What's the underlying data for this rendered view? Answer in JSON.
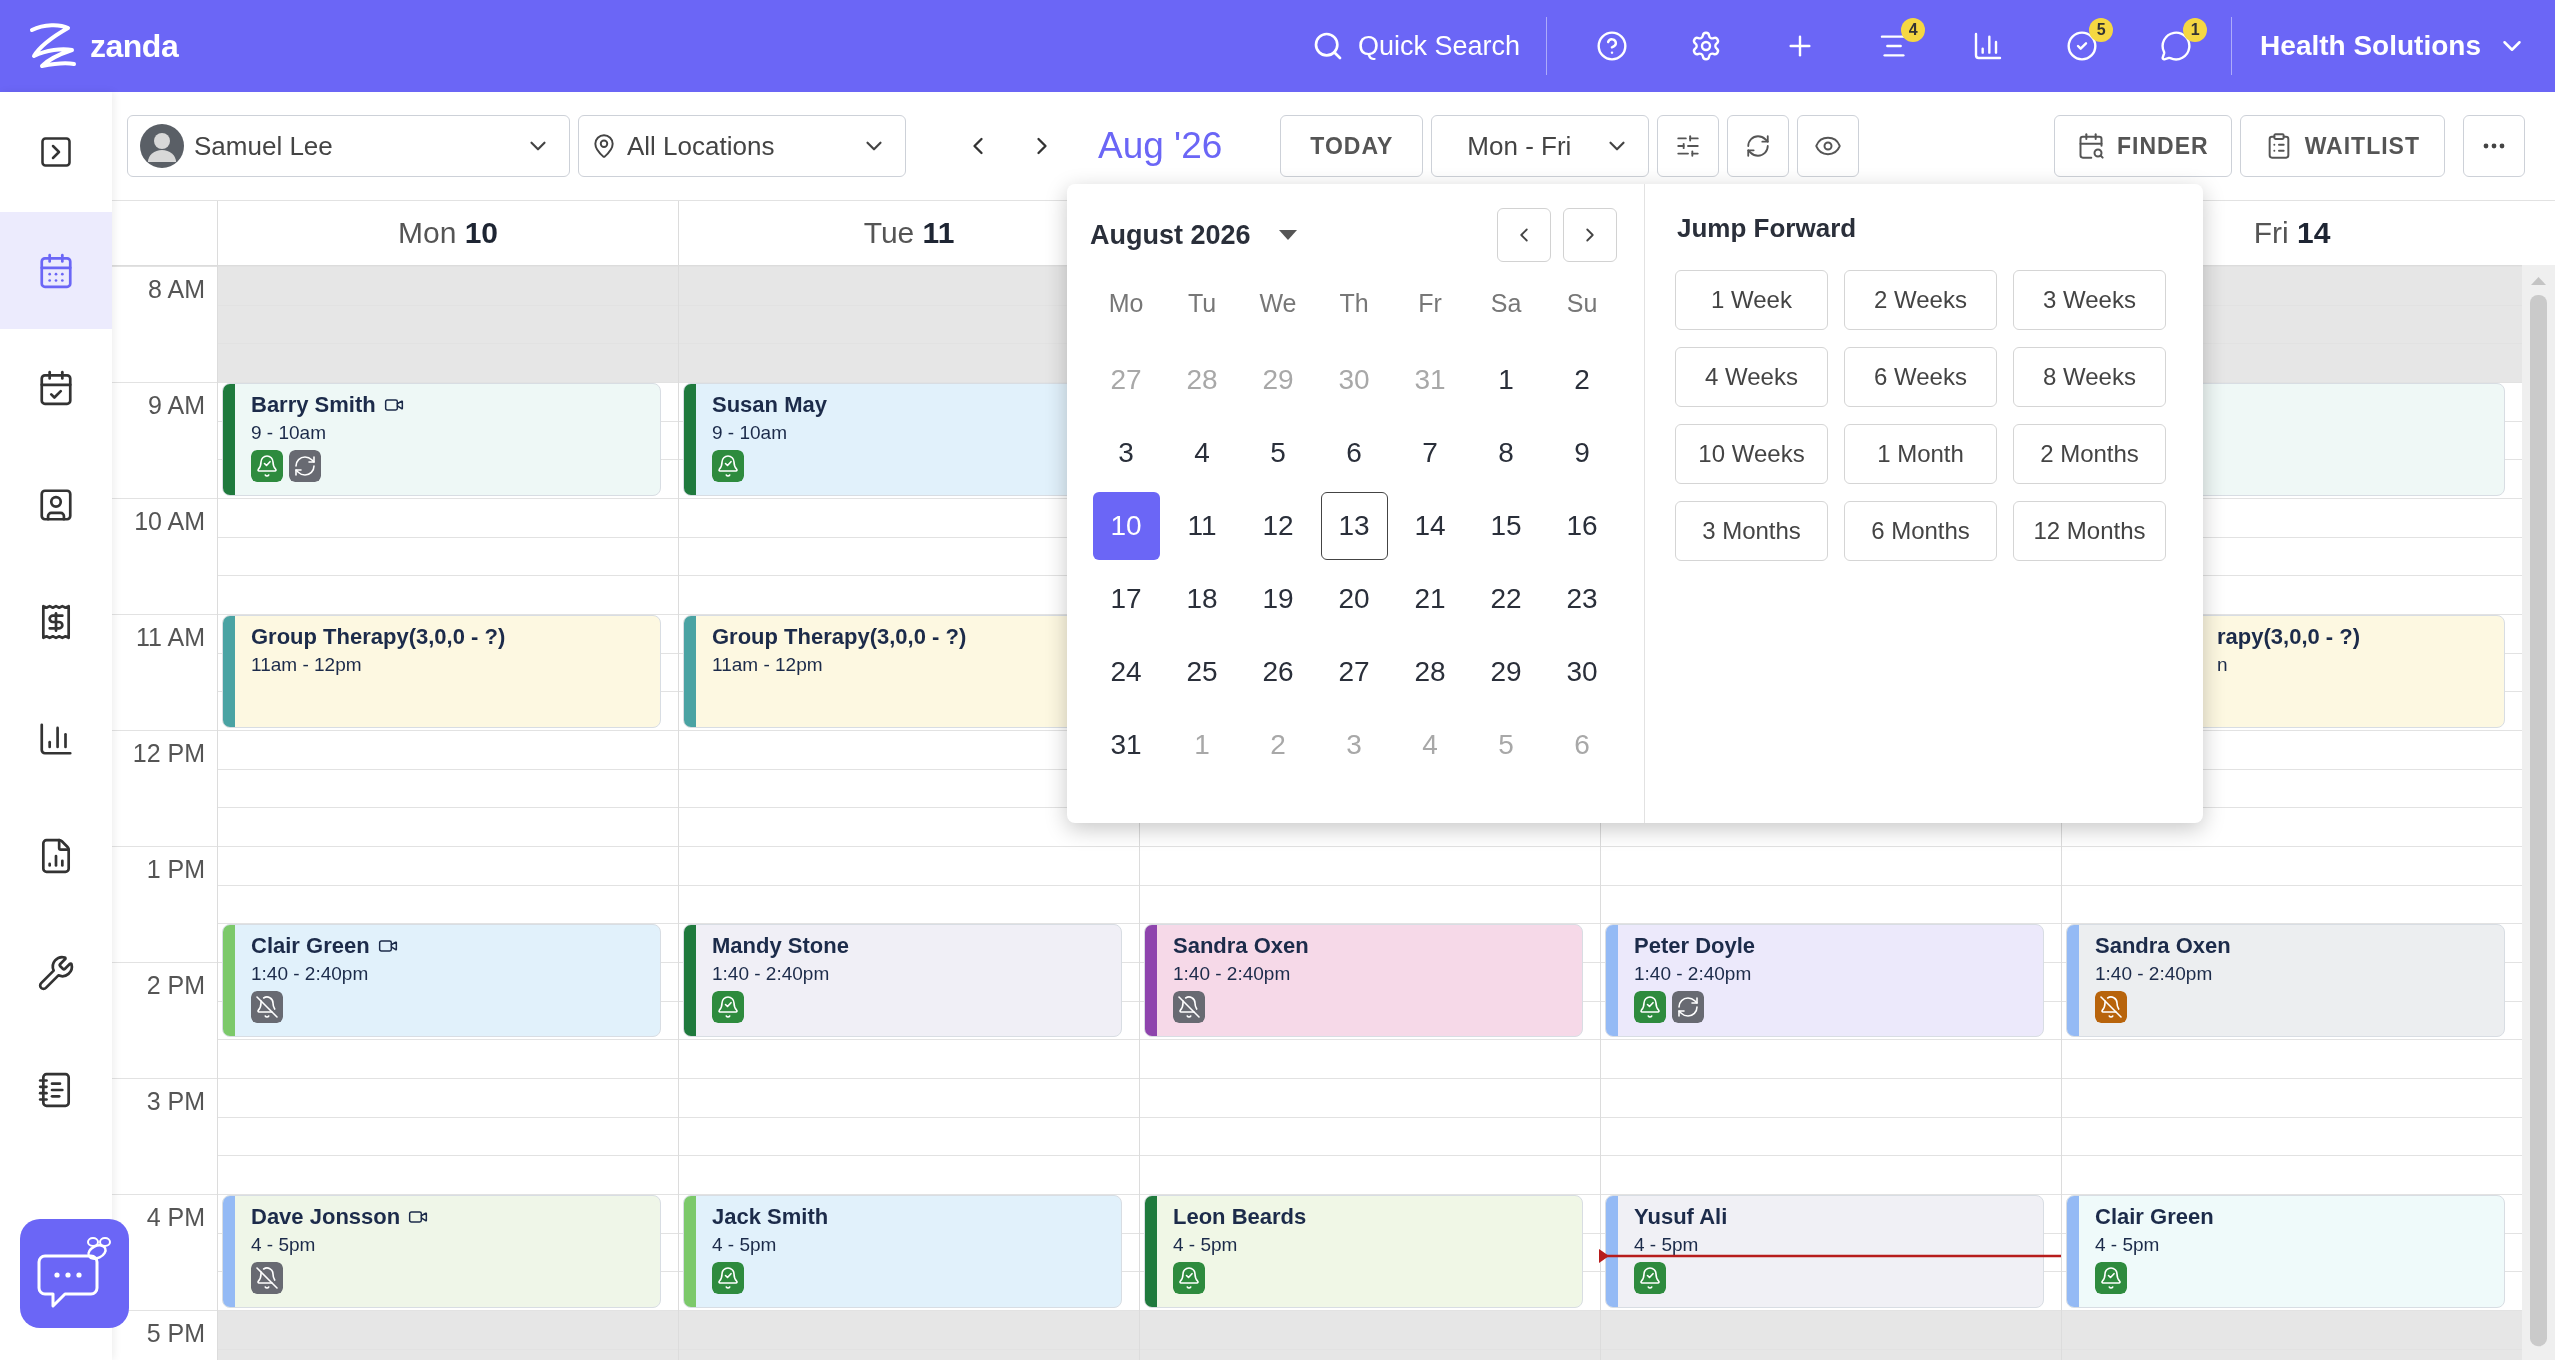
{
  "topbar": {
    "logo": "zanda",
    "search": "Quick Search",
    "actions": [
      {
        "kind": "help"
      },
      {
        "kind": "settings"
      },
      {
        "kind": "add"
      },
      {
        "kind": "tasks",
        "badge": "4"
      },
      {
        "kind": "reports"
      },
      {
        "kind": "checks",
        "badge": "5"
      },
      {
        "kind": "messages",
        "badge": "1"
      }
    ],
    "workspace": "Health Solutions"
  },
  "sidebar": {
    "items": [
      {
        "kind": "calendar",
        "selected": true
      },
      {
        "kind": "appointments",
        "selected": false
      },
      {
        "kind": "clients",
        "selected": false
      },
      {
        "kind": "billing",
        "selected": false
      },
      {
        "kind": "reports",
        "selected": false
      },
      {
        "kind": "documents",
        "selected": false
      },
      {
        "kind": "tools",
        "selected": false
      },
      {
        "kind": "notes",
        "selected": false
      }
    ]
  },
  "toolbar": {
    "practitioner": "Samuel Lee",
    "location": "All Locations",
    "period": "Aug '26",
    "today": "TODAY",
    "range": "Mon - Fri",
    "finder": "FINDER",
    "waitlist": "WAITLIST"
  },
  "calendar": {
    "hours": [
      "8 AM",
      "9 AM",
      "10 AM",
      "11 AM",
      "12 PM",
      "1 PM",
      "2 PM",
      "3 PM",
      "4 PM",
      "5 PM"
    ],
    "current_time_line": true,
    "days": [
      {
        "day": "Mon",
        "date": "10",
        "events": [
          {
            "kind": "morning",
            "name": "Barry Smith",
            "video": true,
            "time": "9 - 10am",
            "color": "#eef8f6",
            "stripe": {
              "color": "#1f7a3d"
            },
            "icons": [
              {
                "kind": "reminder-sent"
              },
              {
                "kind": "recurring"
              }
            ]
          },
          {
            "kind": "midday",
            "name": "Group Therapy(3,0,0 - ?)",
            "time": "11am - 12pm",
            "color": "#fdf8e1",
            "stripe": {
              "color": "#4aa3a3"
            }
          },
          {
            "kind": "afternoon",
            "name": "Clair Green",
            "video": true,
            "time": "1:40 - 2:40pm",
            "color": "#e1f1fb",
            "stripe": {
              "color": "#7cc96a"
            },
            "icons": [
              {
                "kind": "reminder-off"
              }
            ]
          },
          {
            "kind": "evening",
            "name": "Dave Jonsson",
            "video": true,
            "time": "4 - 5pm",
            "color": "#eff6e8",
            "stripe": {
              "color": "#94baf5"
            },
            "icons": [
              {
                "kind": "reminder-off"
              }
            ]
          }
        ]
      },
      {
        "day": "Tue",
        "date": "11",
        "events": [
          {
            "kind": "morning",
            "name": "Susan May",
            "time": "9 - 10am",
            "color": "#e1f1fb",
            "stripe": {
              "color": "#1f7a3d"
            },
            "icons": [
              {
                "kind": "reminder-sent"
              }
            ]
          },
          {
            "kind": "midday",
            "name": "Group Therapy(3,0,0 - ?)",
            "time": "11am - 12pm",
            "color": "#fdf8e1",
            "stripe": {
              "color": "#4aa3a3"
            }
          },
          {
            "kind": "afternoon",
            "name": "Mandy Stone",
            "time": "1:40 - 2:40pm",
            "color": "#f0eff6",
            "stripe": {
              "color": "#1f7a3d"
            },
            "icons": [
              {
                "kind": "reminder-sent"
              }
            ]
          },
          {
            "kind": "evening",
            "name": "Jack Smith",
            "time": "4 - 5pm",
            "color": "#e1f1fb",
            "stripe": {
              "color": "#7cc96a"
            },
            "icons": [
              {
                "kind": "reminder-sent"
              }
            ]
          }
        ]
      },
      {
        "events": [
          {
            "kind": "afternoon",
            "name": "Sandra Oxen",
            "time": "1:40 - 2:40pm",
            "color": "#f6d9e8",
            "stripe": {
              "color": "#8e44ad"
            },
            "icons": [
              {
                "kind": "reminder-off"
              }
            ]
          },
          {
            "kind": "evening",
            "name": "Leon Beards",
            "time": "4 - 5pm",
            "color": "#f0f7e6",
            "stripe": {
              "color": "#1f7a3d"
            },
            "icons": [
              {
                "kind": "reminder-sent"
              }
            ]
          }
        ]
      },
      {
        "events": [
          {
            "kind": "afternoon",
            "name": "Peter Doyle",
            "time": "1:40 - 2:40pm",
            "color": "#ece9fb",
            "stripe": {
              "color": "#94baf5"
            },
            "icons": [
              {
                "kind": "reminder-sent"
              },
              {
                "kind": "recurring"
              }
            ]
          },
          {
            "kind": "evening",
            "name": "Yusuf Ali",
            "time": "4 - 5pm",
            "color": "#f0f0f5",
            "stripe": {
              "color": "#94baf5"
            },
            "icons": [
              {
                "kind": "reminder-sent"
              }
            ]
          }
        ]
      },
      {
        "day": "Fri",
        "date": "14",
        "events": [
          {
            "kind": "morning",
            "color": "#eff8f6"
          },
          {
            "kind": "midday",
            "name": "rapy(3,0,0 - ?)",
            "time": "n",
            "color": "#fdf8e1",
            "covered": true
          },
          {
            "kind": "afternoon",
            "name": "Sandra Oxen",
            "time": "1:40 - 2:40pm",
            "color": "#eceef0",
            "stripe": {
              "color": "#94baf5"
            },
            "icons": [
              {
                "kind": "reminder-off-alert"
              }
            ]
          },
          {
            "kind": "evening",
            "name": "Clair Green",
            "time": "4 - 5pm",
            "color": "#effafa",
            "stripe": {
              "color": "#94baf5"
            },
            "icons": [
              {
                "kind": "reminder-sent"
              }
            ]
          }
        ]
      }
    ]
  },
  "date_picker": {
    "month": "August 2026",
    "weekdays": [
      "Mo",
      "Tu",
      "We",
      "Th",
      "Fr",
      "Sa",
      "Su"
    ],
    "weeks": [
      [
        {
          "label": "27",
          "muted": true,
          "selected": false,
          "today": false
        },
        {
          "label": "28",
          "muted": true,
          "selected": false,
          "today": false
        },
        {
          "label": "29",
          "muted": true,
          "selected": false,
          "today": false
        },
        {
          "label": "30",
          "muted": true,
          "selected": false,
          "today": false
        },
        {
          "label": "31",
          "muted": true,
          "selected": false,
          "today": false
        },
        {
          "label": "1",
          "muted": false,
          "selected": false,
          "today": false
        },
        {
          "label": "2",
          "muted": false,
          "selected": false,
          "today": false
        }
      ],
      [
        {
          "label": "3",
          "muted": false,
          "selected": false,
          "today": false
        },
        {
          "label": "4",
          "muted": false,
          "selected": false,
          "today": false
        },
        {
          "label": "5",
          "muted": false,
          "selected": false,
          "today": false
        },
        {
          "label": "6",
          "muted": false,
          "selected": false,
          "today": false
        },
        {
          "label": "7",
          "muted": false,
          "selected": false,
          "today": false
        },
        {
          "label": "8",
          "muted": false,
          "selected": false,
          "today": false
        },
        {
          "label": "9",
          "muted": false,
          "selected": false,
          "today": false
        }
      ],
      [
        {
          "label": "10",
          "muted": false,
          "selected": true,
          "today": false
        },
        {
          "label": "11",
          "muted": false,
          "selected": false,
          "today": false
        },
        {
          "label": "12",
          "muted": false,
          "selected": false,
          "today": false
        },
        {
          "label": "13",
          "muted": false,
          "selected": false,
          "today": true
        },
        {
          "label": "14",
          "muted": false,
          "selected": false,
          "today": false
        },
        {
          "label": "15",
          "muted": false,
          "selected": false,
          "today": false
        },
        {
          "label": "16",
          "muted": false,
          "selected": false,
          "today": false
        }
      ],
      [
        {
          "label": "17",
          "muted": false,
          "selected": false,
          "today": false
        },
        {
          "label": "18",
          "muted": false,
          "selected": false,
          "today": false
        },
        {
          "label": "19",
          "muted": false,
          "selected": false,
          "today": false
        },
        {
          "label": "20",
          "muted": false,
          "selected": false,
          "today": false
        },
        {
          "label": "21",
          "muted": false,
          "selected": false,
          "today": false
        },
        {
          "label": "22",
          "muted": false,
          "selected": false,
          "today": false
        },
        {
          "label": "23",
          "muted": false,
          "selected": false,
          "today": false
        }
      ],
      [
        {
          "label": "24",
          "muted": false,
          "selected": false,
          "today": false
        },
        {
          "label": "25",
          "muted": false,
          "selected": false,
          "today": false
        },
        {
          "label": "26",
          "muted": false,
          "selected": false,
          "today": false
        },
        {
          "label": "27",
          "muted": false,
          "selected": false,
          "today": false
        },
        {
          "label": "28",
          "muted": false,
          "selected": false,
          "today": false
        },
        {
          "label": "29",
          "muted": false,
          "selected": false,
          "today": false
        },
        {
          "label": "30",
          "muted": false,
          "selected": false,
          "today": false
        }
      ],
      [
        {
          "label": "31",
          "muted": false,
          "selected": false,
          "today": false
        },
        {
          "label": "1",
          "muted": true,
          "selected": false,
          "today": false
        },
        {
          "label": "2",
          "muted": true,
          "selected": false,
          "today": false
        },
        {
          "label": "3",
          "muted": true,
          "selected": false,
          "today": false
        },
        {
          "label": "4",
          "muted": true,
          "selected": false,
          "today": false
        },
        {
          "label": "5",
          "muted": true,
          "selected": false,
          "today": false
        },
        {
          "label": "6",
          "muted": true,
          "selected": false,
          "today": false
        }
      ]
    ],
    "jump_title": "Jump Forward",
    "jump_options": [
      "1 Week",
      "2 Weeks",
      "3 Weeks",
      "4 Weeks",
      "6 Weeks",
      "8 Weeks",
      "10 Weeks",
      "1 Month",
      "2 Months",
      "3 Months",
      "6 Months",
      "12 Months"
    ]
  }
}
